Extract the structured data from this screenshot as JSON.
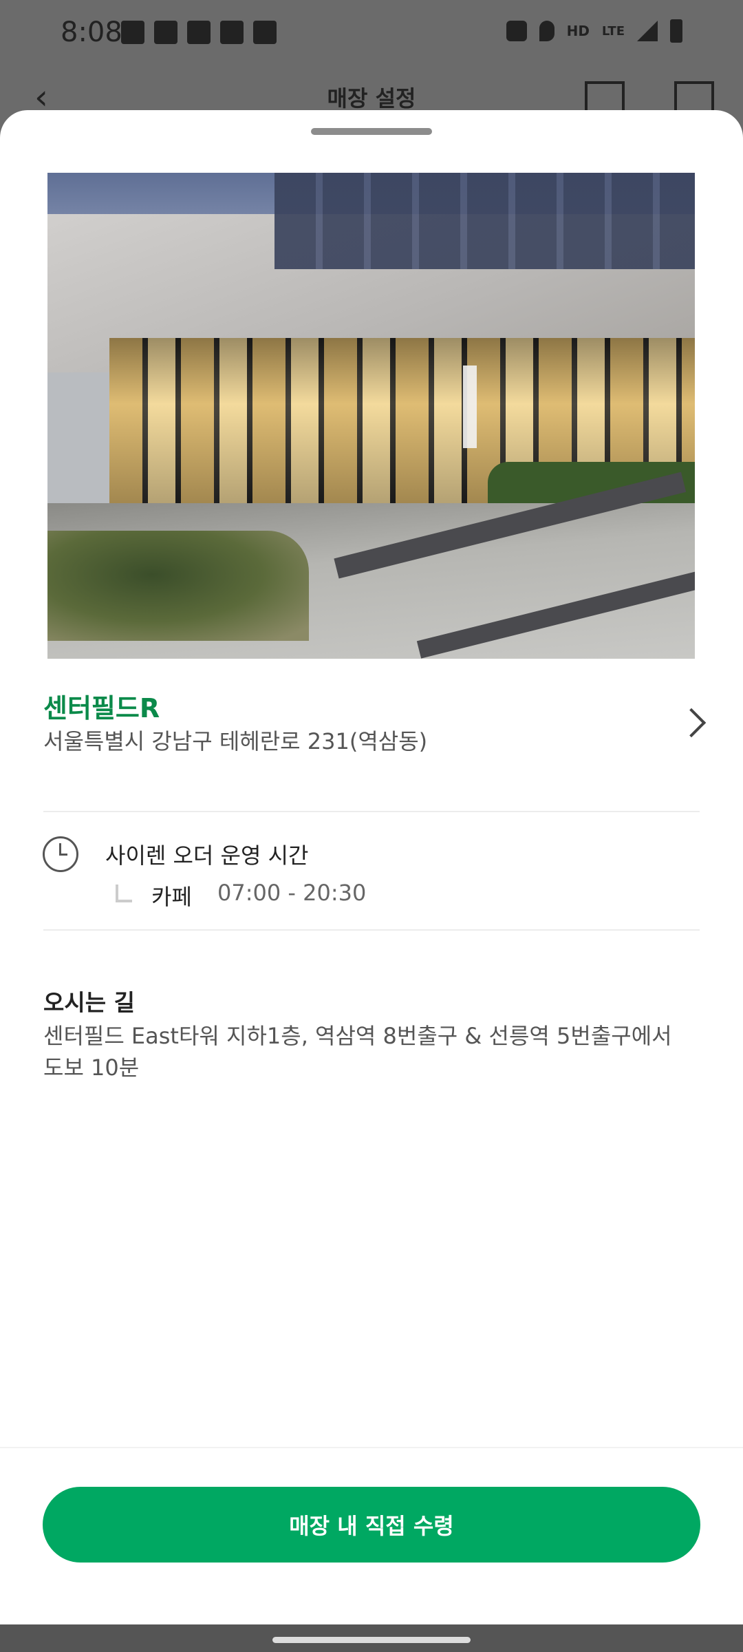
{
  "status_bar": {
    "time": "8:08",
    "hd_label": "HD",
    "lte_label": "LTE"
  },
  "app_bar": {
    "title": "매장 설정"
  },
  "store": {
    "name": "센터필드R",
    "address": "서울특별시 강남구 테헤란로 231(역삼동)"
  },
  "hours": {
    "title": "사이렌 오더 운영 시간",
    "label": "카페",
    "value": "07:00 - 20:30"
  },
  "directions": {
    "title": "오시는 길",
    "text": "센터필드 East타워 지하1층, 역삼역 8번출구 & 선릉역 5번출구에서 도보 10분"
  },
  "pickup_button": {
    "label": "매장 내 직접 수령"
  },
  "colors": {
    "brand_green": "#00a862",
    "store_name_green": "#0b8a4a"
  },
  "icons": [
    "back-arrow-icon",
    "scan-icon",
    "map-icon",
    "clock-icon",
    "chevron-right-icon"
  ]
}
